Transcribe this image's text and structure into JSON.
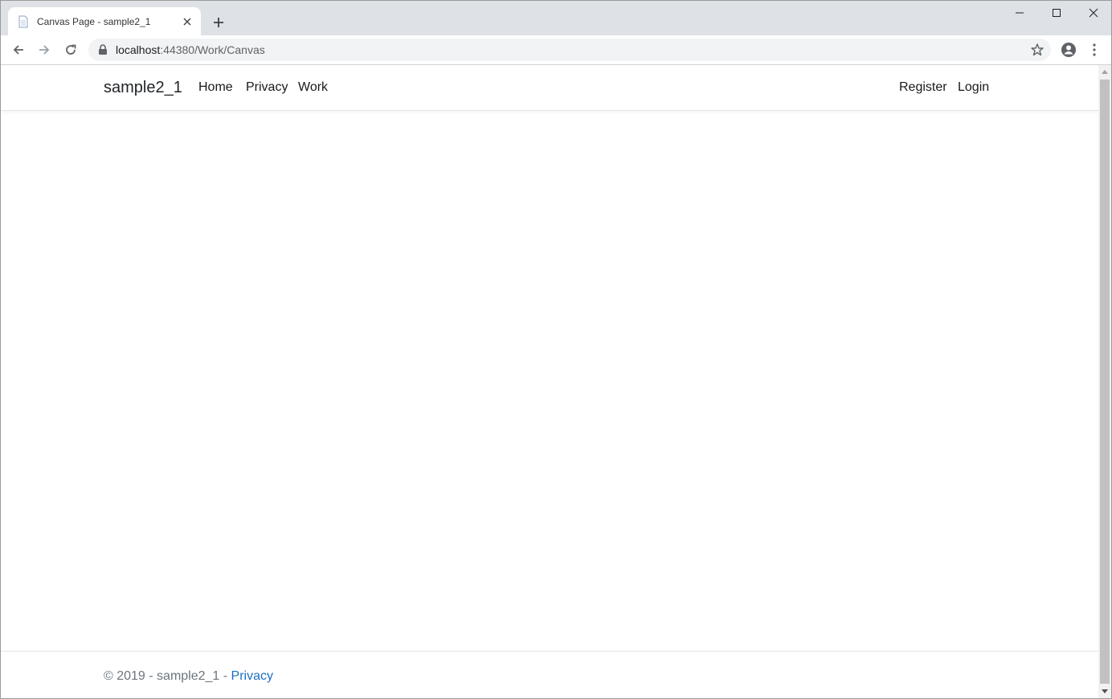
{
  "browser": {
    "tab": {
      "title": "Canvas Page - sample2_1",
      "favicon": "page-icon"
    },
    "new_tab_icon": "plus-icon",
    "window_controls": [
      "minimize-icon",
      "maximize-icon",
      "close-icon"
    ],
    "toolbar": {
      "back_icon": "arrow-left-icon",
      "forward_icon": "arrow-right-icon",
      "reload_icon": "reload-icon"
    },
    "address": {
      "host": "localhost",
      "path": ":44380/Work/Canvas"
    },
    "bookmark_icon": "star-icon",
    "profile_icon": "account-icon",
    "menu_icon": "more-vert-icon"
  },
  "site": {
    "brand": "sample2_1",
    "nav_left": [
      "Home",
      "Privacy",
      "Work"
    ],
    "nav_right": [
      "Register",
      "Login"
    ],
    "footer": {
      "text": "© 2019 - sample2_1 - ",
      "link": "Privacy"
    }
  },
  "colors": {
    "tabstrip": "#dee1e6",
    "link": "#1b6ec2",
    "footer_text": "#6c757d"
  }
}
